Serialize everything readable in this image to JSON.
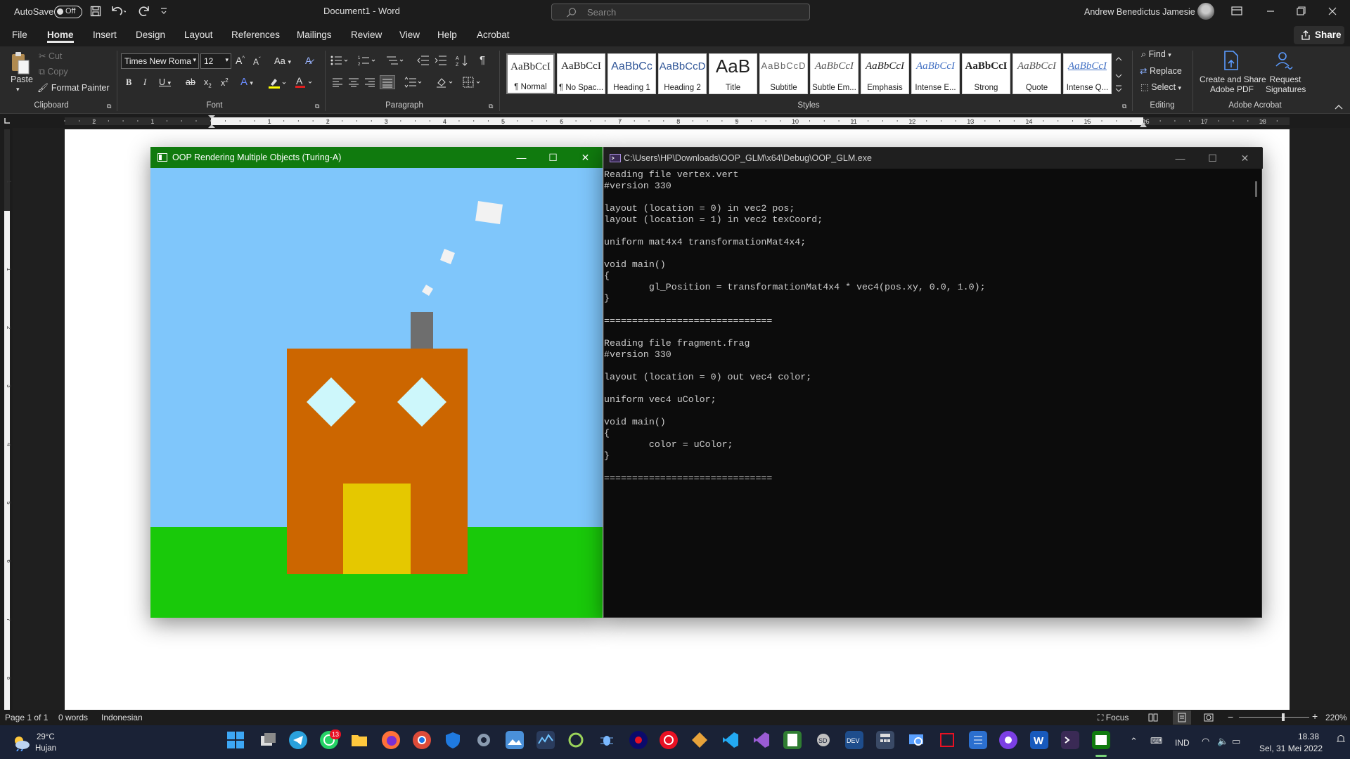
{
  "titlebar": {
    "autosave_label": "AutoSave",
    "autosave_state": "Off",
    "doc_title": "Document1  -  Word",
    "search_placeholder": "Search",
    "user_name": "Andrew Benedictus Jamesie"
  },
  "menu": {
    "items": [
      "File",
      "Home",
      "Insert",
      "Design",
      "Layout",
      "References",
      "Mailings",
      "Review",
      "View",
      "Help",
      "Acrobat"
    ],
    "active": "Home",
    "share_label": "Share"
  },
  "ribbon": {
    "clipboard": {
      "paste": "Paste",
      "cut": "Cut",
      "copy": "Copy",
      "format_painter": "Format Painter",
      "label": "Clipboard"
    },
    "font": {
      "name": "Times New Roma",
      "size": "12",
      "case_btn": "Aa",
      "label": "Font"
    },
    "paragraph": {
      "label": "Paragraph"
    },
    "styles": {
      "label": "Styles",
      "items": [
        {
          "sample": "AaBbCcI",
          "name": "¶ Normal"
        },
        {
          "sample": "AaBbCcI",
          "name": "¶ No Spac..."
        },
        {
          "sample": "AaBbCc",
          "name": "Heading 1"
        },
        {
          "sample": "AaBbCcD",
          "name": "Heading 2"
        },
        {
          "sample": "AaB",
          "name": "Title"
        },
        {
          "sample": "AaBbCcD",
          "name": "Subtitle"
        },
        {
          "sample": "AaBbCcI",
          "name": "Subtle Em..."
        },
        {
          "sample": "AaBbCcI",
          "name": "Emphasis"
        },
        {
          "sample": "AaBbCcI",
          "name": "Intense E..."
        },
        {
          "sample": "AaBbCcI",
          "name": "Strong"
        },
        {
          "sample": "AaBbCcI",
          "name": "Quote"
        },
        {
          "sample": "AaBbCcI",
          "name": "Intense Q..."
        }
      ]
    },
    "editing": {
      "find": "Find",
      "replace": "Replace",
      "select": "Select",
      "label": "Editing"
    },
    "acrobat": {
      "create_share_1": "Create and Share",
      "create_share_2": "Adobe PDF",
      "request_1": "Request",
      "request_2": "Signatures",
      "label": "Adobe Acrobat"
    }
  },
  "ruler": {
    "h_ticks": [
      "2",
      "1",
      "1",
      "2",
      "3",
      "4",
      "5",
      "6",
      "7",
      "8",
      "9",
      "10",
      "11",
      "12",
      "13",
      "14",
      "15",
      "16",
      "17",
      "18"
    ],
    "v_ticks": [
      "1",
      "1",
      "2",
      "3",
      "4",
      "5",
      "6",
      "7",
      "8"
    ]
  },
  "gl_window": {
    "title": "OOP Rendering Multiple Objects (Turing-A)",
    "colors": {
      "sky": "#7fc6fb",
      "grass": "#19c90a",
      "house": "#cc6600",
      "door": "#e5c800",
      "window": "#cdf7fb",
      "chimney": "#6e6e6e",
      "smoke": "#f2f2f2",
      "titlebar": "#107a0e"
    }
  },
  "console": {
    "title": "C:\\Users\\HP\\Downloads\\OOP_GLM\\x64\\Debug\\OOP_GLM.exe",
    "lines": [
      "Reading file vertex.vert",
      "#version 330",
      "",
      "layout (location = 0) in vec2 pos;",
      "layout (location = 1) in vec2 texCoord;",
      "",
      "uniform mat4x4 transformationMat4x4;",
      "",
      "void main()",
      "{",
      "        gl_Position = transformationMat4x4 * vec4(pos.xy, 0.0, 1.0);",
      "}",
      "",
      "==============================",
      "",
      "Reading file fragment.frag",
      "#version 330",
      "",
      "layout (location = 0) out vec4 color;",
      "",
      "uniform vec4 uColor;",
      "",
      "void main()",
      "{",
      "        color = uColor;",
      "}",
      "",
      "=============================="
    ]
  },
  "statusbar": {
    "page": "Page 1 of 1",
    "words": "0 words",
    "language": "Indonesian",
    "focus": "Focus",
    "zoom": "220%"
  },
  "taskbar": {
    "weather_temp": "29°C",
    "weather_desc": "Hujan",
    "whatsapp_badge": "13",
    "lang": "IND",
    "time": "18.38",
    "date": "Sel, 31 Mei 2022"
  }
}
